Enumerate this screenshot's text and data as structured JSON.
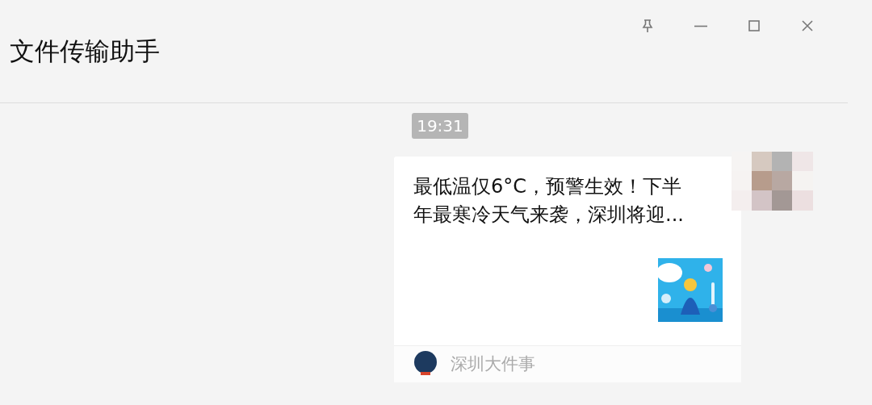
{
  "window": {
    "title": "文件传输助手"
  },
  "messages": [
    {
      "kind": "time",
      "text": "19:31"
    },
    {
      "kind": "article",
      "title": "最低温仅6°C，预警生效！下半年最寒冷天气来袭，深圳将迎...",
      "source": "深圳大件事"
    }
  ]
}
